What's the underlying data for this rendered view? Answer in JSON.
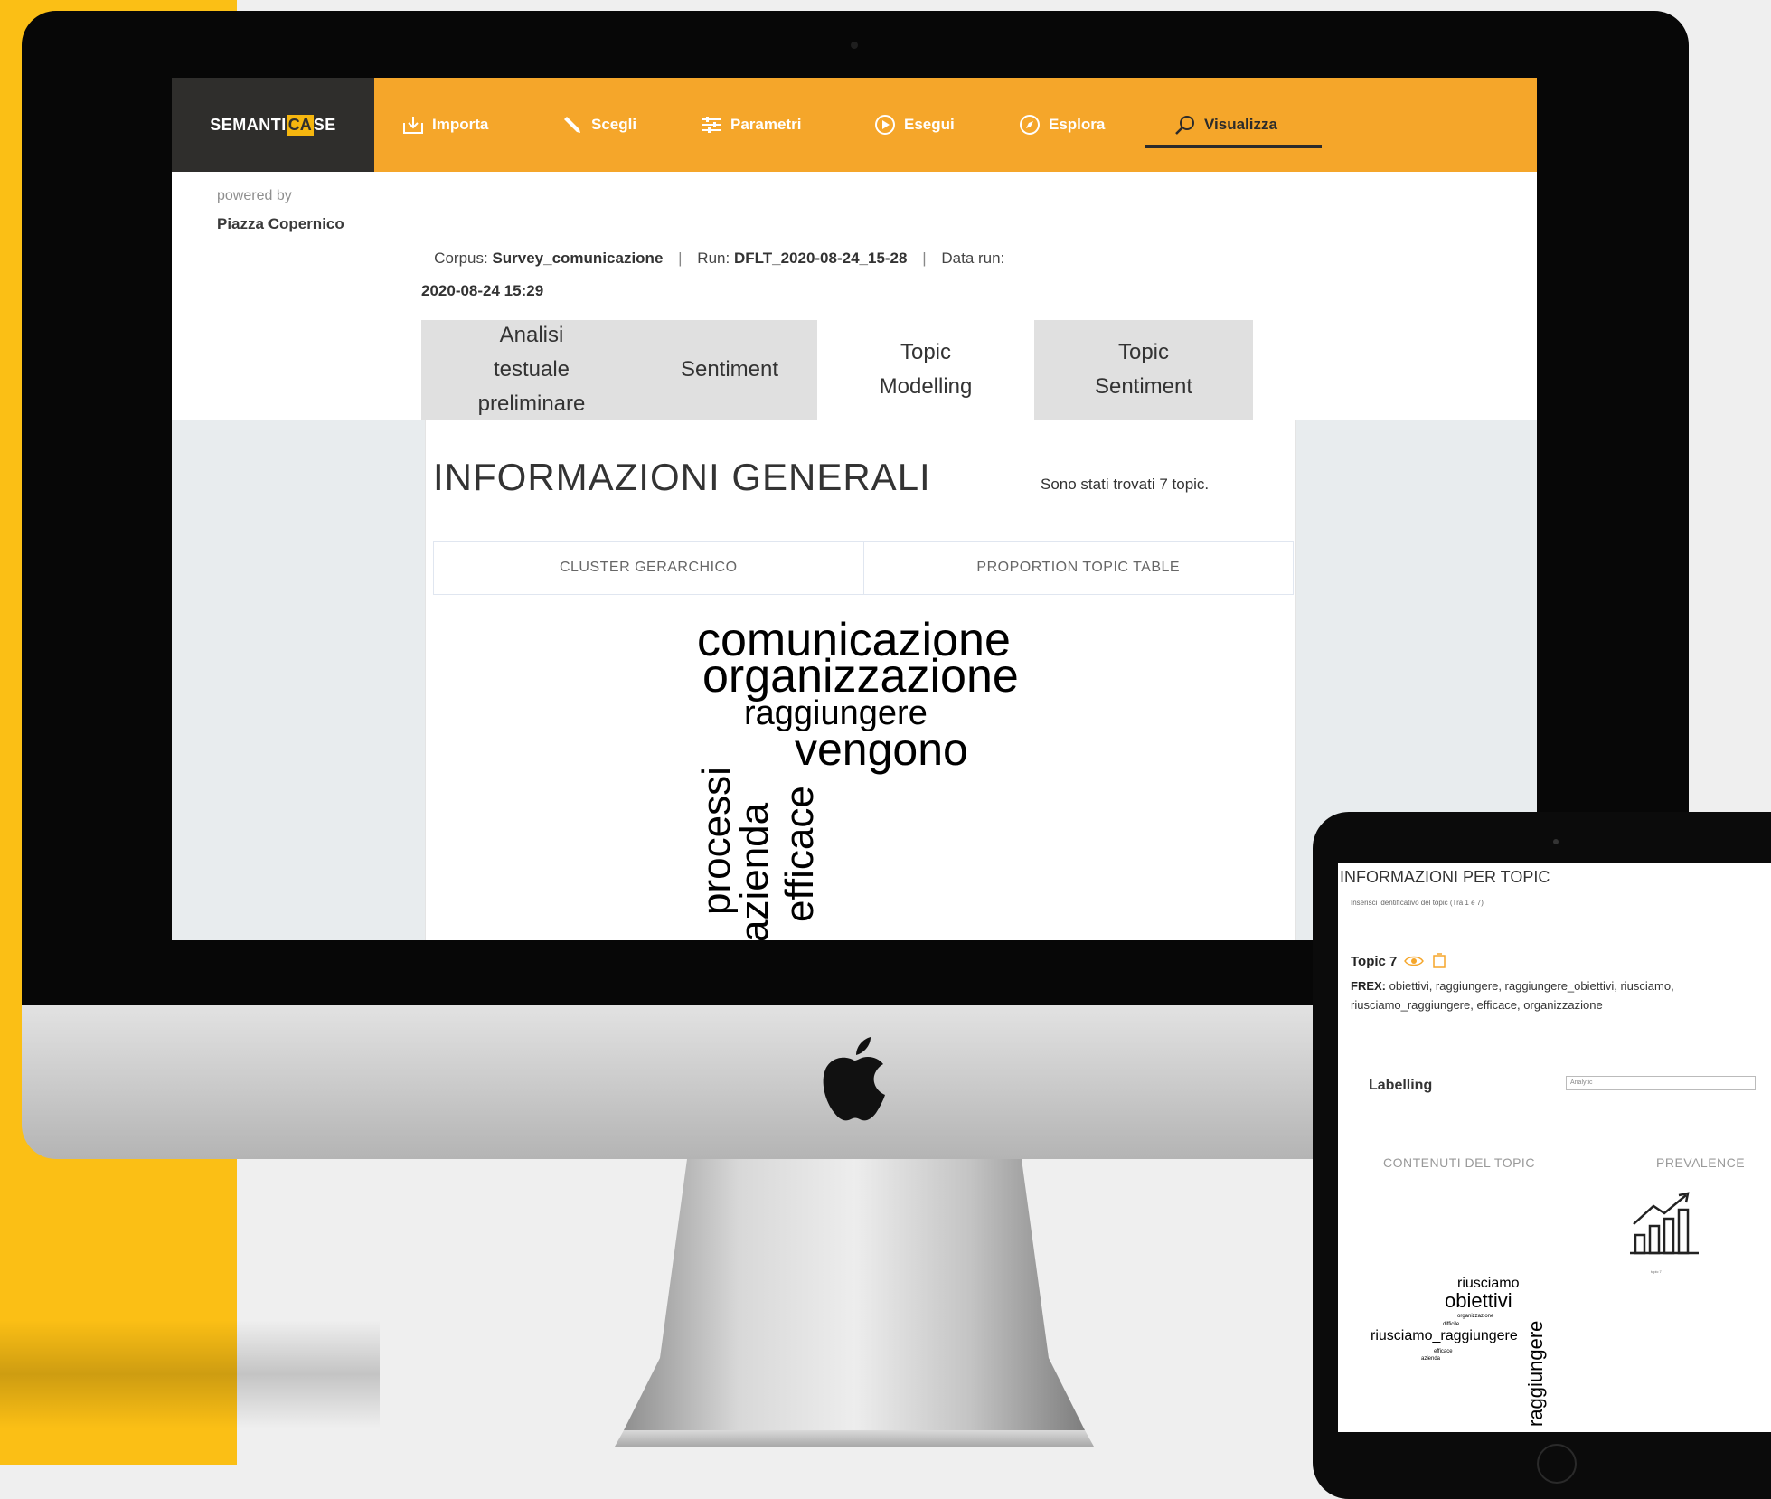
{
  "app": {
    "logo": {
      "part1": "SEMANTI",
      "part2": "CA",
      "part3": "SE"
    },
    "nav": [
      {
        "label": "Importa",
        "icon": "import-icon"
      },
      {
        "label": "Scegli",
        "icon": "pencil-icon"
      },
      {
        "label": "Parametri",
        "icon": "sliders-icon"
      },
      {
        "label": "Esegui",
        "icon": "play-icon"
      },
      {
        "label": "Esplora",
        "icon": "compass-icon"
      },
      {
        "label": "Visualizza",
        "icon": "search-icon",
        "active": true
      }
    ],
    "accent_color": "#f5a62a",
    "dark_color": "#2f2e2c"
  },
  "powered": {
    "label": "powered by",
    "name": "Piazza Copernico"
  },
  "run_info": {
    "corpus_label": "Corpus:",
    "corpus_value": "Survey_comunicazione",
    "run_label": "Run:",
    "run_value": "DFLT_2020-08-24_15-28",
    "date_label": "Data run:",
    "date_value": "2020-08-24 15:29",
    "separator": "|"
  },
  "tabs": [
    {
      "line1": "Analisi",
      "line2": "testuale",
      "line3": "preliminare",
      "active": false
    },
    {
      "line1": "Sentiment",
      "active": false
    },
    {
      "line1": "Topic",
      "line2": "Modelling",
      "active": true
    },
    {
      "line1": "Topic",
      "line2": "Sentiment",
      "active": false
    }
  ],
  "main": {
    "title": "INFORMAZIONI GENERALI",
    "subtitle": "Sono stati trovati 7 topic.",
    "subtabs": [
      "CLUSTER GERARCHICO",
      "PROPORTION TOPIC TABLE"
    ]
  },
  "wordcloud": [
    "comunicazione",
    "organizzazione",
    "raggiungere",
    "vengono",
    "processi",
    "azienda",
    "efficace"
  ],
  "tablet": {
    "title": "INFORMAZIONI PER TOPIC",
    "subtitle": "Inserisci identificativo del topic (Tra 1 e 7)",
    "topic_label": "Topic 7",
    "frex_label": "FREX:",
    "frex_text": "obiettivi, raggiungere, raggiungere_obiettivi, riusciamo, riusciamo_raggiungere, efficace, organizzazione",
    "labelling_label": "Labelling",
    "labelling_placeholder": "Analytic",
    "contents_label": "CONTENUTI DEL TOPIC",
    "prevalence_label": "PREVALENCE",
    "chart_caption": "topic 7",
    "wordcloud": [
      "riusciamo",
      "obiettivi",
      "organizzazione",
      "difficile",
      "riusciamo_raggiungere",
      "raggiungere",
      "efficace",
      "azienda"
    ],
    "icon_color": "#f5a62a"
  }
}
